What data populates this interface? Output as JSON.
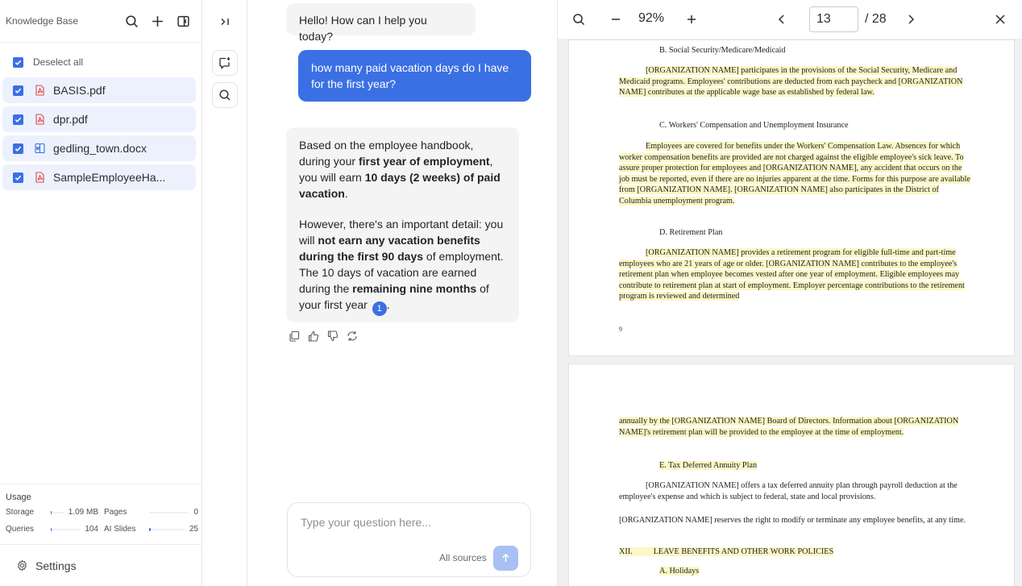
{
  "sidebar": {
    "title": "Knowledge Base",
    "deselect_label": "Deselect all",
    "files": [
      {
        "name": "BASIS.pdf",
        "type": "pdf"
      },
      {
        "name": "dpr.pdf",
        "type": "pdf"
      },
      {
        "name": "gedling_town.docx",
        "type": "docx"
      },
      {
        "name": "SampleEmployeeHa...",
        "type": "pdf"
      }
    ],
    "usage": {
      "title": "Usage",
      "storage": {
        "label": "Storage",
        "value": "1.09 MB",
        "fraction": 0.01
      },
      "pages": {
        "label": "Pages",
        "value": "0",
        "fraction": 0
      },
      "queries": {
        "label": "Queries",
        "value": "104",
        "fraction": 0.02
      },
      "ai_slides": {
        "label": "AI Slides",
        "value": "25",
        "fraction": 0.05
      }
    },
    "settings_label": "Settings"
  },
  "chat": {
    "greeting": "Hello! How can I help you today?",
    "user_question": "how many paid vacation days do I have for the first year?",
    "answer": {
      "p1": [
        "Based on the employee handbook, during your ",
        "first year of employment",
        ", you will earn ",
        "10 days (2 weeks) of paid vacation",
        "."
      ],
      "p2": [
        "However, there's an important detail: you will ",
        "not earn any vacation benefits during the first 90 days",
        " of employment. The 10 days of vacation are earned during the ",
        "remaining nine months",
        " of your first year "
      ],
      "citation": "1",
      "p2_end": "."
    },
    "composer": {
      "placeholder": "Type your question here...",
      "sources_label": "All sources"
    }
  },
  "viewer": {
    "zoom": "92%",
    "current_page": "13",
    "total_pages": "/ 28",
    "page_a": {
      "heading_b": "B.   Social Security/Medicare/Medicaid",
      "para_b": "[ORGANIZATION NAME] participates in the provisions of the Social Security, Medicare and Medicaid programs.  Employees' contributions are deducted from each paycheck and [ORGANIZATION NAME] contributes at the applicable wage base as established by federal law.",
      "heading_c": "C.   Workers' Compensation and Unemployment Insurance",
      "para_c": "Employees are covered for benefits under the Workers' Compensation Law.  Absences for which worker compensation benefits are provided are not charged against the eligible employee's sick leave.  To assure proper protection for employees and [ORGANIZATION NAME], any accident that occurs on the job must be reported, even if there are no injuries apparent at the time.  Forms for this purpose are available from [ORGANIZATION NAME]. [ORGANIZATION NAME] also participates in the District of Columbia unemployment program.",
      "heading_d": "D.   Retirement Plan",
      "para_d": "[ORGANIZATION NAME] provides a retirement program for eligible full-time and part-time employees who are 21 years of age or older.  [ORGANIZATION NAME] contributes to the employee's retirement plan when employee becomes vested after one year of employment.  Eligible employees may contribute to retirement plan at start of employment.  Employer percentage contributions to the retirement program is reviewed and determined",
      "page_number": "9"
    },
    "page_b": {
      "para_cont": "annually by the [ORGANIZATION NAME] Board of Directors.  Information about [ORGANIZATION NAME]'s retirement plan will be provided to the employee at the time of employment.",
      "heading_e": "E.   Tax Deferred Annuity Plan",
      "para_e": "[ORGANIZATION NAME] offers a tax deferred annuity plan through payroll deduction at the employee's expense and which is subject to federal, state and local provisions.",
      "para_reserve": "[ORGANIZATION NAME] reserves the right to modify or terminate any employee benefits, at any time.",
      "section_num": "XII.",
      "section_title": "LEAVE BENEFITS AND OTHER WORK POLICIES",
      "heading_a": "A.   Holidays"
    }
  }
}
